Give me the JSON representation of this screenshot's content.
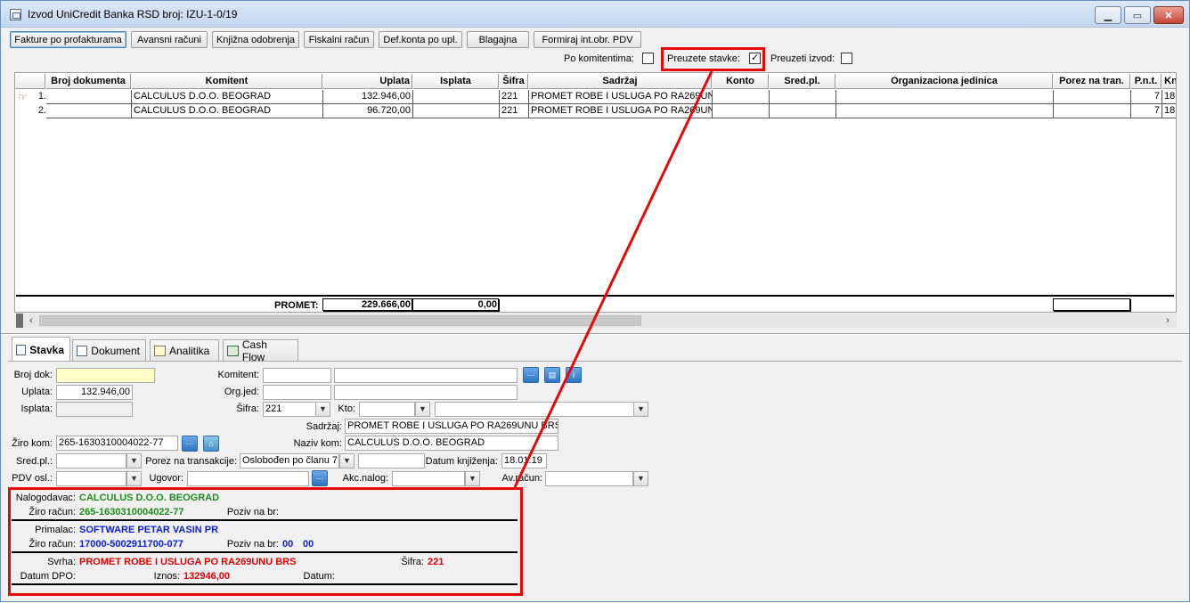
{
  "window": {
    "title": "Izvod UniCredit Banka RSD broj: IZU-1-0/19"
  },
  "toolbar": {
    "buttons": [
      "Fakture po profakturama",
      "Avansni računi",
      "Knjižna odobrenja",
      "Fiskalni račun",
      "Def.konta po upl.",
      "Blagajna",
      "Formiraj int.obr. PDV"
    ]
  },
  "options": {
    "po_komitentima": {
      "label": "Po komitentima:",
      "checked": false
    },
    "preuzete_stavke": {
      "label": "Preuzete stavke:",
      "checked": true
    },
    "preuzeti_izvod": {
      "label": "Preuzeti izvod:",
      "checked": false
    }
  },
  "grid": {
    "columns": [
      "Broj dokumenta",
      "Komitent",
      "Uplata",
      "Isplata",
      "Šifra",
      "Sadržaj",
      "Konto",
      "Sred.pl.",
      "Organizaciona jedinica",
      "Porez na tran.",
      "P.n.t.",
      "Kn"
    ],
    "rows": [
      {
        "no": "1.",
        "broj": "",
        "komitent": "CALCULUS  D.O.O. BEOGRAD",
        "uplata": "132.946,00",
        "isplata": "",
        "sifra": "221",
        "sadrzaj": "PROMET ROBE I USLUGA PO RA269UNU BR",
        "konto": "",
        "sredpl": "",
        "org": "",
        "porez": "",
        "pnt": "7",
        "kn": "18."
      },
      {
        "no": "2.",
        "broj": "",
        "komitent": "CALCULUS  D.O.O. BEOGRAD",
        "uplata": "96.720,00",
        "isplata": "",
        "sifra": "221",
        "sadrzaj": "PROMET ROBE I USLUGA PO RA269UNU BR",
        "konto": "",
        "sredpl": "",
        "org": "",
        "porez": "",
        "pnt": "7",
        "kn": "18."
      }
    ],
    "totals": {
      "label": "PROMET:",
      "uplata": "229.666,00",
      "isplata": "0,00",
      "porez": ""
    }
  },
  "tabs": [
    "Stavka",
    "Dokument",
    "Analitika",
    "Cash Flow"
  ],
  "form": {
    "broj_dok": {
      "label": "Broj dok:",
      "value": ""
    },
    "uplata": {
      "label": "Uplata:",
      "value": "132.946,00"
    },
    "isplata": {
      "label": "Isplata:",
      "value": ""
    },
    "komitent": {
      "label": "Komitent:",
      "value": "",
      "name": ""
    },
    "org_jed": {
      "label": "Org.jed:",
      "value": "",
      "name": ""
    },
    "sifra": {
      "label": "Šifra:",
      "value": "221"
    },
    "kto": {
      "label": "Kto:",
      "value": "",
      "name": ""
    },
    "sadrzaj": {
      "label": "Sadržaj:",
      "value": "PROMET ROBE I USLUGA PO RA269UNU BRS"
    },
    "ziro_kom": {
      "label": "Žiro kom:",
      "value": "265-1630310004022-77"
    },
    "naziv_kom": {
      "label": "Naziv kom:",
      "value": "CALCULUS  D.O.O. BEOGRAD"
    },
    "sred_pl": {
      "label": "Sred.pl.:",
      "value": ""
    },
    "porez_na_transakcije": {
      "label": "Porez na transakcije:",
      "value": "Oslobođen po članu 7",
      "extra": ""
    },
    "datum_knjizenja": {
      "label": "Datum knjiženja:",
      "value": "18.01.19"
    },
    "pdv_osl": {
      "label": "PDV osl.:",
      "value": ""
    },
    "ugovor": {
      "label": "Ugovor:",
      "value": ""
    },
    "akc_nalog": {
      "label": "Akc.nalog:",
      "value": ""
    },
    "av_racun": {
      "label": "Av.račun:",
      "value": ""
    }
  },
  "payment_info": {
    "nalogodavac_label": "Nalogodavac:",
    "nalogodavac": "CALCULUS  D.O.O. BEOGRAD",
    "ziro_racun_label": "Žiro račun:",
    "nalogodavac_ziro": "265-1630310004022-77",
    "poziv_label": "Poziv na br:",
    "nalogodavac_poziv": "",
    "primalac_label": "Primalac:",
    "primalac": "SOFTWARE PETAR VASIN PR",
    "primalac_ziro": "17000-5002911700-077",
    "primalac_poziv_1": "00",
    "primalac_poziv_2": "00",
    "svrha_label": "Svrha:",
    "svrha": "PROMET ROBE I USLUGA PO RA269UNU BRS",
    "sifra_label": "Šifra:",
    "sifra": "221",
    "datum_dpo_label": "Datum DPO:",
    "iznos_label": "Iznos:",
    "iznos": "132946,00",
    "datum_label": "Datum:"
  },
  "colors": {
    "highlight_red": "#e4090a",
    "green_text": "#1e8a1e",
    "blue_text": "#1020d0",
    "red_text": "#e00000"
  }
}
